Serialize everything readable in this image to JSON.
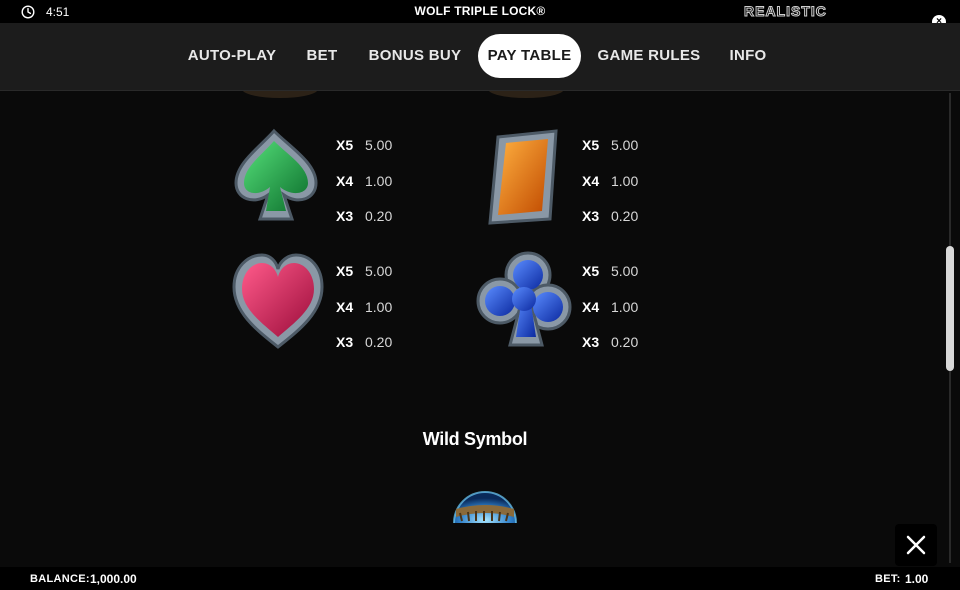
{
  "status_bar": {
    "time": "4:51",
    "game_title": "WOLF TRIPLE LOCK®",
    "brand": "REALISTIC"
  },
  "nav": {
    "tabs": [
      {
        "label": "AUTO-PLAY",
        "active": false
      },
      {
        "label": "BET",
        "active": false
      },
      {
        "label": "BONUS BUY",
        "active": false
      },
      {
        "label": "PAY TABLE",
        "active": true
      },
      {
        "label": "GAME RULES",
        "active": false
      },
      {
        "label": "INFO",
        "active": false
      }
    ]
  },
  "paytable": {
    "symbols": [
      {
        "name": "spade",
        "color": "#1fae4b",
        "pays": [
          {
            "mult": "X5",
            "value": "5.00"
          },
          {
            "mult": "X4",
            "value": "1.00"
          },
          {
            "mult": "X3",
            "value": "0.20"
          }
        ]
      },
      {
        "name": "diamond",
        "color": "#f07a10",
        "pays": [
          {
            "mult": "X5",
            "value": "5.00"
          },
          {
            "mult": "X4",
            "value": "1.00"
          },
          {
            "mult": "X3",
            "value": "0.20"
          }
        ]
      },
      {
        "name": "heart",
        "color": "#e0245e",
        "pays": [
          {
            "mult": "X5",
            "value": "5.00"
          },
          {
            "mult": "X4",
            "value": "1.00"
          },
          {
            "mult": "X3",
            "value": "0.20"
          }
        ]
      },
      {
        "name": "club",
        "color": "#2a5fe0",
        "pays": [
          {
            "mult": "X5",
            "value": "5.00"
          },
          {
            "mult": "X4",
            "value": "1.00"
          },
          {
            "mult": "X3",
            "value": "0.20"
          }
        ]
      }
    ]
  },
  "wild": {
    "title": "Wild Symbol"
  },
  "footer": {
    "balance_label": "BALANCE:",
    "balance_value": "1,000.00",
    "bet_label": "BET:",
    "bet_value": "1.00"
  }
}
